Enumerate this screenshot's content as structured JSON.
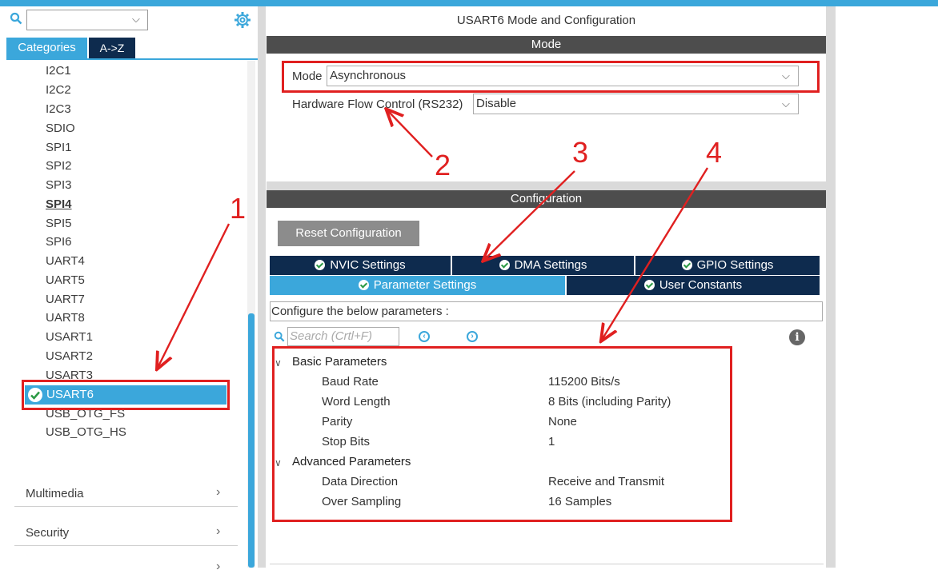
{
  "left_panel": {
    "tabs": {
      "categories": "Categories",
      "az": "A->Z"
    },
    "items": [
      "I2C1",
      "I2C2",
      "I2C3",
      "SDIO",
      "SPI1",
      "SPI2",
      "SPI3",
      "SPI4",
      "SPI5",
      "SPI6",
      "UART4",
      "UART5",
      "UART7",
      "UART8",
      "USART1",
      "USART2",
      "USART3"
    ],
    "selected_item": "USART6",
    "items_after": [
      "USB_OTG_FS",
      "USB_OTG_HS"
    ],
    "categories": [
      "Multimedia",
      "Security"
    ]
  },
  "right_panel": {
    "title": "USART6 Mode and Configuration",
    "mode_bar": "Mode",
    "mode": {
      "label": "Mode",
      "value": "Asynchronous"
    },
    "flow_control": {
      "label": "Hardware Flow Control (RS232)",
      "value": "Disable"
    },
    "config_bar": "Configuration",
    "reset_button": "Reset Configuration",
    "tabs_row1": [
      "NVIC Settings",
      "DMA Settings",
      "GPIO Settings"
    ],
    "tabs_row2": [
      "Parameter Settings",
      "User Constants"
    ],
    "configure_text": "Configure the below parameters :",
    "search_placeholder": "Search (Crtl+F)",
    "basic_section": "Basic Parameters",
    "basic": [
      {
        "name": "Baud Rate",
        "value": "115200 Bits/s"
      },
      {
        "name": "Word Length",
        "value": "8 Bits (including Parity)"
      },
      {
        "name": "Parity",
        "value": "None"
      },
      {
        "name": "Stop Bits",
        "value": "1"
      }
    ],
    "advanced_section": "Advanced Parameters",
    "advanced": [
      {
        "name": "Data Direction",
        "value": "Receive and Transmit"
      },
      {
        "name": "Over Sampling",
        "value": "16 Samples"
      }
    ]
  },
  "annotations": {
    "n1": "1",
    "n2": "2",
    "n3": "3",
    "n4": "4"
  },
  "colors": {
    "accent": "#3ba7db",
    "dark_tab": "#0e2b4e",
    "annotation": "#e02020"
  }
}
